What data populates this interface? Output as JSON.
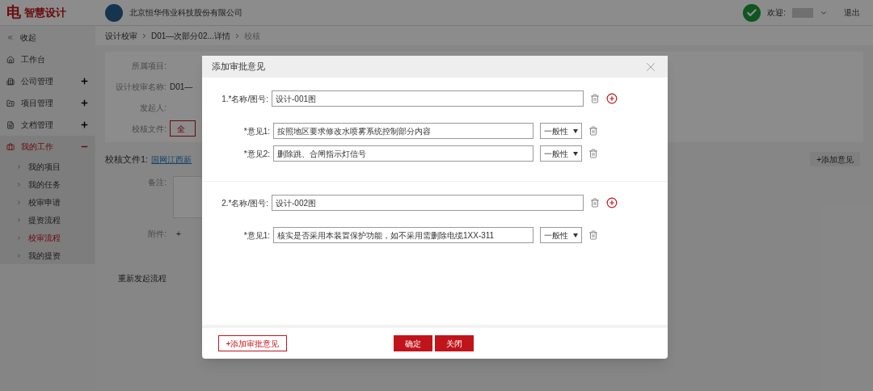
{
  "header": {
    "logo_mark": "电",
    "logo_text": "智慧设计",
    "company": "北京恒华伟业科技股份有限公司",
    "welcome": "欢迎:",
    "logout": "退出"
  },
  "sidebar": {
    "collapse": "收起",
    "items": [
      {
        "label": "工作台",
        "kind": "link",
        "selected": false
      },
      {
        "label": "公司管理",
        "kind": "group",
        "expanded": false,
        "selected": false
      },
      {
        "label": "项目管理",
        "kind": "group",
        "expanded": false,
        "selected": false
      },
      {
        "label": "文档管理",
        "kind": "group",
        "expanded": false,
        "selected": false
      },
      {
        "label": "我的工作",
        "kind": "group",
        "expanded": true,
        "selected": true,
        "children": [
          {
            "label": "我的项目",
            "selected": false
          },
          {
            "label": "我的任务",
            "selected": false
          },
          {
            "label": "校审申请",
            "selected": false
          },
          {
            "label": "提资流程",
            "selected": false
          },
          {
            "label": "校审流程",
            "selected": true
          },
          {
            "label": "我的提资",
            "selected": false
          }
        ]
      }
    ]
  },
  "breadcrumb": [
    "设计校审",
    "D01—次部分02...详情",
    "校核"
  ],
  "form": {
    "fields": [
      {
        "label": "所属项目:"
      },
      {
        "label": "设计校审名称:",
        "value": "D01—"
      },
      {
        "label": "发起人:"
      },
      {
        "label": "校核文件:",
        "button": "全"
      }
    ],
    "file_label": "校核文件1:",
    "file_link": "国网江西新",
    "add_opinion": "+添加意见",
    "remark_label": "备注:",
    "attachment_label": "附件:",
    "attachment_button": "+",
    "restart": "重新发起流程"
  },
  "modal": {
    "title": "添加审批意见",
    "groups": [
      {
        "label": "1.*名称/图号:",
        "value": "设计-001图",
        "opinions": [
          {
            "label": "*意见1:",
            "value": "按照地区要求修改水喷雾系统控制部分内容",
            "severity": "一般性"
          },
          {
            "label": "*意见2:",
            "value": "删除跳、合闸指示灯信号",
            "severity": "一般性"
          }
        ]
      },
      {
        "label": "2.*名称/图号:",
        "value": "设计-002图",
        "opinions": [
          {
            "label": "*意见1:",
            "value": "核实是否采用本装置保护功能，如不采用需删除电缆1XX-311",
            "severity": "一般性"
          }
        ]
      }
    ],
    "add_button": "+添加审批意见",
    "confirm": "确定",
    "close": "关闭"
  }
}
